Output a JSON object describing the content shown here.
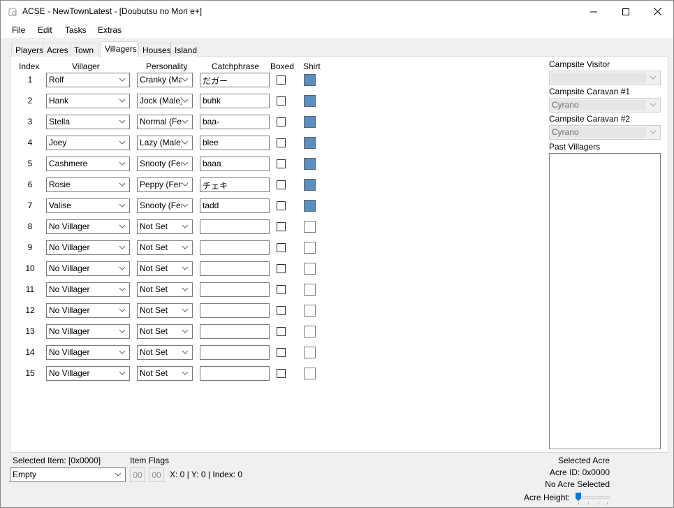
{
  "window": {
    "title": "ACSE - NewTownLatest - [Doubutsu no Mori e+]",
    "controls": {
      "minimize": "minimize",
      "maximize": "maximize",
      "close": "close"
    }
  },
  "menu": [
    "File",
    "Edit",
    "Tasks",
    "Extras"
  ],
  "tabs": [
    {
      "label": "Players",
      "active": false
    },
    {
      "label": "Acres",
      "active": false
    },
    {
      "label": "Town",
      "active": false
    },
    {
      "label": "Villagers",
      "active": true
    },
    {
      "label": "Houses",
      "active": false
    },
    {
      "label": "Island",
      "active": false
    }
  ],
  "villagers": {
    "headers": {
      "index": "Index",
      "villager": "Villager",
      "personality": "Personality",
      "catchphrase": "Catchphrase",
      "boxed": "Boxed",
      "shirt": "Shirt"
    },
    "shirt_color": "#5b8fbf",
    "rows": [
      {
        "index": "1",
        "villager": "Rolf",
        "personality": "Cranky (Male)",
        "catchphrase": "だガー",
        "boxed": false,
        "has_shirt": true
      },
      {
        "index": "2",
        "villager": "Hank",
        "personality": "Jock (Male)",
        "catchphrase": "buhk",
        "boxed": false,
        "has_shirt": true
      },
      {
        "index": "3",
        "villager": "Stella",
        "personality": "Normal (Female)",
        "catchphrase": "baa-",
        "boxed": false,
        "has_shirt": true
      },
      {
        "index": "4",
        "villager": "Joey",
        "personality": "Lazy (Male)",
        "catchphrase": "blee",
        "boxed": false,
        "has_shirt": true
      },
      {
        "index": "5",
        "villager": "Cashmere",
        "personality": "Snooty (Female)",
        "catchphrase": "baaa",
        "boxed": false,
        "has_shirt": true
      },
      {
        "index": "6",
        "villager": "Rosie",
        "personality": "Peppy (Female)",
        "catchphrase": "チェキ",
        "boxed": false,
        "has_shirt": true
      },
      {
        "index": "7",
        "villager": "Valise",
        "personality": "Snooty (Female)",
        "catchphrase": "tadd",
        "boxed": false,
        "has_shirt": true
      },
      {
        "index": "8",
        "villager": "No Villager",
        "personality": "Not Set",
        "catchphrase": "",
        "boxed": false,
        "has_shirt": false
      },
      {
        "index": "9",
        "villager": "No Villager",
        "personality": "Not Set",
        "catchphrase": "",
        "boxed": false,
        "has_shirt": false
      },
      {
        "index": "10",
        "villager": "No Villager",
        "personality": "Not Set",
        "catchphrase": "",
        "boxed": false,
        "has_shirt": false
      },
      {
        "index": "11",
        "villager": "No Villager",
        "personality": "Not Set",
        "catchphrase": "",
        "boxed": false,
        "has_shirt": false
      },
      {
        "index": "12",
        "villager": "No Villager",
        "personality": "Not Set",
        "catchphrase": "",
        "boxed": false,
        "has_shirt": false
      },
      {
        "index": "13",
        "villager": "No Villager",
        "personality": "Not Set",
        "catchphrase": "",
        "boxed": false,
        "has_shirt": false
      },
      {
        "index": "14",
        "villager": "No Villager",
        "personality": "Not Set",
        "catchphrase": "",
        "boxed": false,
        "has_shirt": false
      },
      {
        "index": "15",
        "villager": "No Villager",
        "personality": "Not Set",
        "catchphrase": "",
        "boxed": false,
        "has_shirt": false
      }
    ]
  },
  "sidebar": {
    "campsite_visitor_label": "Campsite Visitor",
    "campsite_visitor_value": "",
    "caravan1_label": "Campsite Caravan #1",
    "caravan1_value": "Cyrano",
    "caravan2_label": "Campsite Caravan #2",
    "caravan2_value": "Cyrano",
    "past_villagers_label": "Past Villagers"
  },
  "bottom": {
    "selected_item_label": "Selected Item: [0x0000]",
    "selected_item_value": "Empty",
    "item_flags_label": "Item Flags",
    "flag1": "00",
    "flag2": "00",
    "coords": "X: 0 | Y: 0 | Index: 0",
    "selected_acre_label": "Selected Acre",
    "acre_id": "Acre ID: 0x0000",
    "acre_status": "No Acre Selected",
    "acre_height_label": "Acre Height:",
    "acre_height_value": 0
  }
}
